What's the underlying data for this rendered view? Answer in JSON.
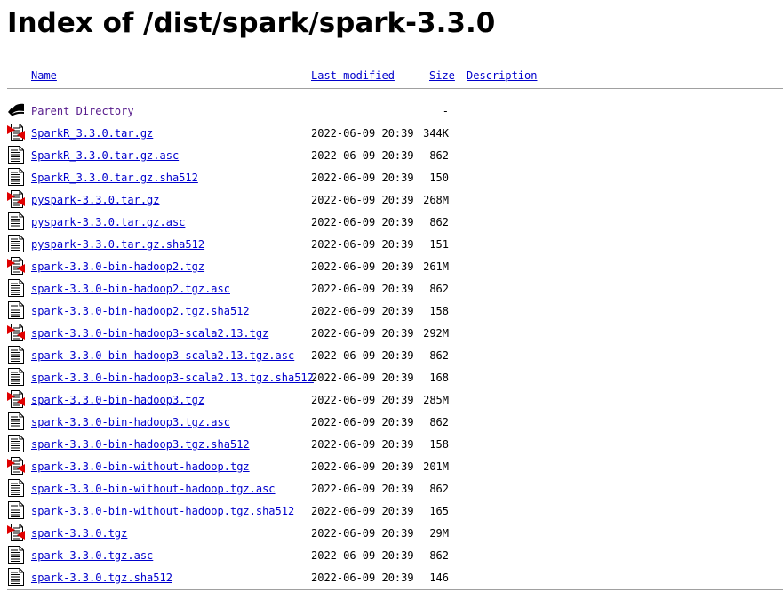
{
  "page": {
    "title": "Index of /dist/spark/spark-3.3.0"
  },
  "columns": {
    "name": "Name",
    "last_modified": "Last modified",
    "size": "Size",
    "description": "Description"
  },
  "parent": {
    "label": "Parent Directory",
    "size": "-",
    "icon": "back-arrow-icon"
  },
  "files": [
    {
      "name": "SparkR_3.3.0.tar.gz",
      "modified": "2022-06-09 20:39",
      "size": "344K",
      "type": "archive"
    },
    {
      "name": "SparkR_3.3.0.tar.gz.asc",
      "modified": "2022-06-09 20:39",
      "size": "862",
      "type": "text"
    },
    {
      "name": "SparkR_3.3.0.tar.gz.sha512",
      "modified": "2022-06-09 20:39",
      "size": "150",
      "type": "text"
    },
    {
      "name": "pyspark-3.3.0.tar.gz",
      "modified": "2022-06-09 20:39",
      "size": "268M",
      "type": "archive"
    },
    {
      "name": "pyspark-3.3.0.tar.gz.asc",
      "modified": "2022-06-09 20:39",
      "size": "862",
      "type": "text"
    },
    {
      "name": "pyspark-3.3.0.tar.gz.sha512",
      "modified": "2022-06-09 20:39",
      "size": "151",
      "type": "text"
    },
    {
      "name": "spark-3.3.0-bin-hadoop2.tgz",
      "modified": "2022-06-09 20:39",
      "size": "261M",
      "type": "archive"
    },
    {
      "name": "spark-3.3.0-bin-hadoop2.tgz.asc",
      "modified": "2022-06-09 20:39",
      "size": "862",
      "type": "text"
    },
    {
      "name": "spark-3.3.0-bin-hadoop2.tgz.sha512",
      "modified": "2022-06-09 20:39",
      "size": "158",
      "type": "text"
    },
    {
      "name": "spark-3.3.0-bin-hadoop3-scala2.13.tgz",
      "modified": "2022-06-09 20:39",
      "size": "292M",
      "type": "archive"
    },
    {
      "name": "spark-3.3.0-bin-hadoop3-scala2.13.tgz.asc",
      "modified": "2022-06-09 20:39",
      "size": "862",
      "type": "text"
    },
    {
      "name": "spark-3.3.0-bin-hadoop3-scala2.13.tgz.sha512",
      "modified": "2022-06-09 20:39",
      "size": "168",
      "type": "text"
    },
    {
      "name": "spark-3.3.0-bin-hadoop3.tgz",
      "modified": "2022-06-09 20:39",
      "size": "285M",
      "type": "archive"
    },
    {
      "name": "spark-3.3.0-bin-hadoop3.tgz.asc",
      "modified": "2022-06-09 20:39",
      "size": "862",
      "type": "text"
    },
    {
      "name": "spark-3.3.0-bin-hadoop3.tgz.sha512",
      "modified": "2022-06-09 20:39",
      "size": "158",
      "type": "text"
    },
    {
      "name": "spark-3.3.0-bin-without-hadoop.tgz",
      "modified": "2022-06-09 20:39",
      "size": "201M",
      "type": "archive"
    },
    {
      "name": "spark-3.3.0-bin-without-hadoop.tgz.asc",
      "modified": "2022-06-09 20:39",
      "size": "862",
      "type": "text"
    },
    {
      "name": "spark-3.3.0-bin-without-hadoop.tgz.sha512",
      "modified": "2022-06-09 20:39",
      "size": "165",
      "type": "text"
    },
    {
      "name": "spark-3.3.0.tgz",
      "modified": "2022-06-09 20:39",
      "size": "29M",
      "type": "archive"
    },
    {
      "name": "spark-3.3.0.tgz.asc",
      "modified": "2022-06-09 20:39",
      "size": "862",
      "type": "text"
    },
    {
      "name": "spark-3.3.0.tgz.sha512",
      "modified": "2022-06-09 20:39",
      "size": "146",
      "type": "text"
    }
  ],
  "icons": {
    "archive": "compressed-file-icon",
    "text": "text-file-icon"
  },
  "colors": {
    "link": "#0000cc",
    "visited_link": "#551a8b",
    "rule": "#a0a0a0"
  }
}
